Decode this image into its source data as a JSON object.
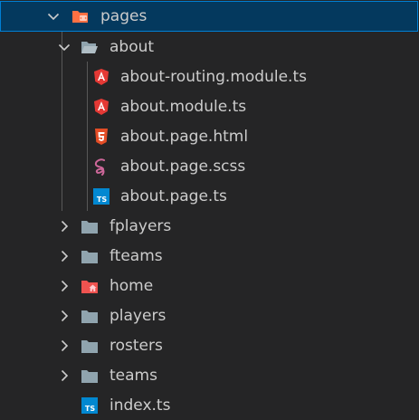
{
  "explorer": {
    "items": [
      {
        "label": "pages",
        "icon": "folder-src-open-icon",
        "expanded": true,
        "selected": true
      },
      {
        "label": "about",
        "icon": "folder-open-icon",
        "expanded": true
      },
      {
        "label": "about-routing.module.ts",
        "icon": "angular-icon"
      },
      {
        "label": "about.module.ts",
        "icon": "angular-icon"
      },
      {
        "label": "about.page.html",
        "icon": "html5-icon"
      },
      {
        "label": "about.page.scss",
        "icon": "sass-icon"
      },
      {
        "label": "about.page.ts",
        "icon": "typescript-icon"
      },
      {
        "label": "fplayers",
        "icon": "folder-icon",
        "expanded": false
      },
      {
        "label": "fteams",
        "icon": "folder-icon",
        "expanded": false
      },
      {
        "label": "home",
        "icon": "folder-home-icon",
        "expanded": false
      },
      {
        "label": "players",
        "icon": "folder-icon",
        "expanded": false
      },
      {
        "label": "rosters",
        "icon": "folder-icon",
        "expanded": false
      },
      {
        "label": "teams",
        "icon": "folder-icon",
        "expanded": false
      },
      {
        "label": "index.ts",
        "icon": "typescript-icon"
      }
    ]
  },
  "colors": {
    "background": "#252526",
    "selection": "#04395e",
    "selection_border": "#007fd4",
    "text": "#cccccc",
    "folder": "#90a4ae",
    "folder_src": "#ff7043",
    "folder_home": "#ef5350",
    "angular": "#e53935",
    "html5": "#e44d26",
    "sass": "#cd6799",
    "typescript": "#0288d1"
  }
}
